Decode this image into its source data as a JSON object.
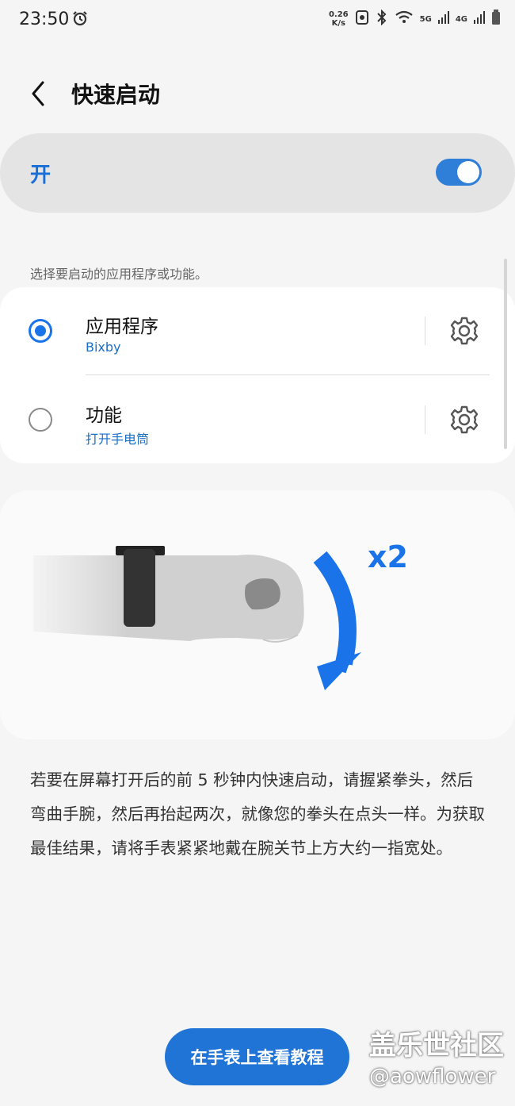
{
  "status_bar": {
    "time": "23:50",
    "net_speed_value": "0.26",
    "net_speed_unit": "K/s",
    "signal1_label": "5G",
    "signal2_label": "4G",
    "icons": [
      "alarm-icon",
      "data-saver-icon",
      "bluetooth-icon",
      "wifi-icon",
      "signal-icon",
      "battery-icon"
    ]
  },
  "header": {
    "title": "快速启动"
  },
  "master_toggle": {
    "label": "开",
    "state": "on"
  },
  "hint": "选择要启动的应用程序或功能。",
  "options": [
    {
      "title": "应用程序",
      "subtitle": "Bixby",
      "selected": true
    },
    {
      "title": "功能",
      "subtitle": "打开手电筒",
      "selected": false
    }
  ],
  "illustration": {
    "repeat_label": "x2"
  },
  "description": "若要在屏幕打开后的前 5 秒钟内快速启动，请握紧拳头，然后弯曲手腕，然后再抬起两次，就像您的拳头在点头一样。为获取最佳结果，请将手表紧紧地戴在腕关节上方大约一指宽处。",
  "cta_button": "在手表上查看教程",
  "watermark": {
    "line1": "盖乐世社区",
    "line2": "@aowflower"
  },
  "colors": {
    "accent": "#1a73e8",
    "background": "#f5f5f5",
    "card": "#ffffff"
  }
}
